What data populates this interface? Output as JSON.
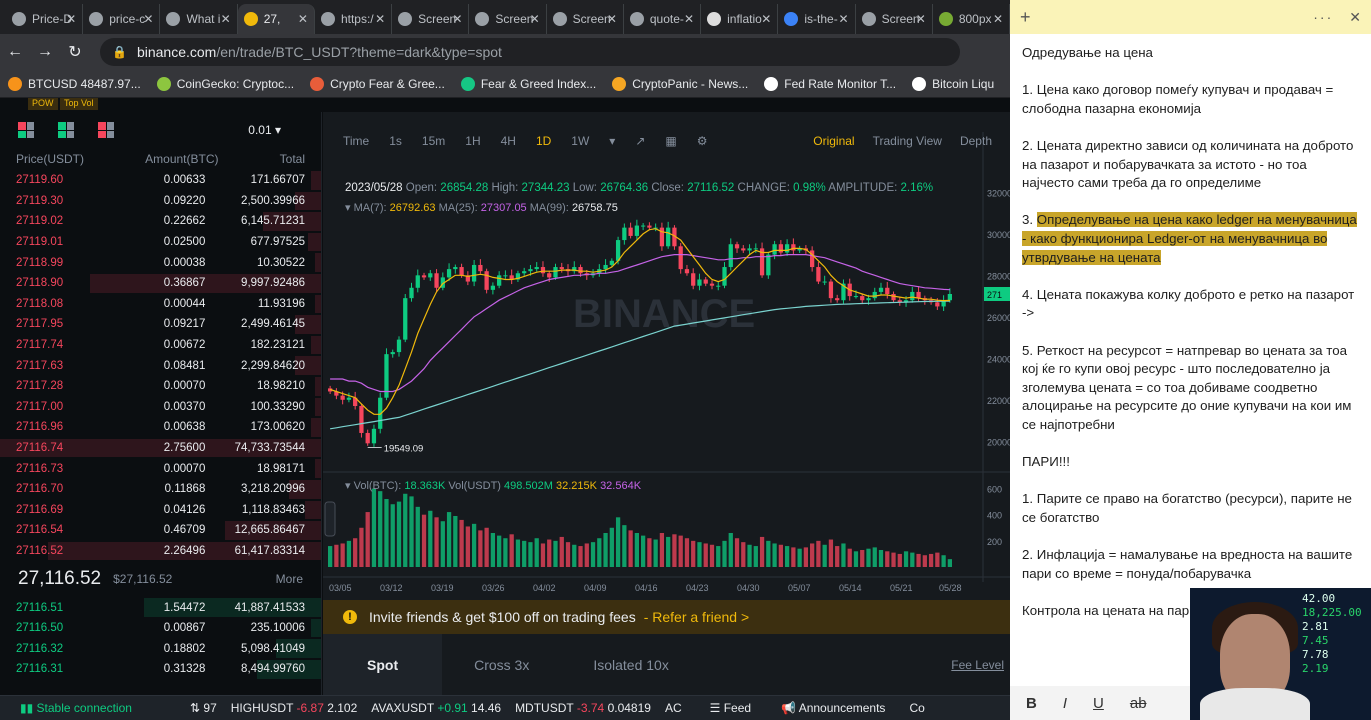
{
  "browser": {
    "tabs": [
      {
        "label": "Price-D",
        "color": "#9aa0a6"
      },
      {
        "label": "price-c",
        "color": "#9aa0a6"
      },
      {
        "label": "What i",
        "color": "#9aa0a6"
      },
      {
        "label": "27,",
        "color": "#f0b90b"
      },
      {
        "label": "https:/",
        "color": "#9aa0a6"
      },
      {
        "label": "Screen",
        "color": "#9aa0a6"
      },
      {
        "label": "Screen",
        "color": "#9aa0a6"
      },
      {
        "label": "Screen",
        "color": "#9aa0a6"
      },
      {
        "label": "quote-",
        "color": "#9aa0a6"
      },
      {
        "label": "inflatio",
        "color": "#dddddd"
      },
      {
        "label": "is-the-",
        "color": "#3b82f6"
      },
      {
        "label": "Screen",
        "color": "#9aa0a6"
      },
      {
        "label": "800px",
        "color": "#7a3"
      }
    ],
    "url_host": "binance.com",
    "url_path": "/en/trade/BTC_USDT?theme=dark&type=spot",
    "bookmarks": [
      {
        "label": "BTCUSD 48487.97...",
        "color": "#f7931a"
      },
      {
        "label": "CoinGecko: Cryptoc...",
        "color": "#8dc63f"
      },
      {
        "label": "Crypto Fear & Gree...",
        "color": "#e85d3a"
      },
      {
        "label": "Fear & Greed Index...",
        "color": "#16c784"
      },
      {
        "label": "CryptoPanic - News...",
        "color": "#f5a623"
      },
      {
        "label": "Fed Rate Monitor T...",
        "color": "#ffffff"
      },
      {
        "label": "Bitcoin Liqu",
        "color": "#ffffff"
      }
    ],
    "sub_tags": [
      "POW",
      "Top Vol"
    ]
  },
  "orderbook": {
    "precision": "0.01",
    "headers": {
      "price": "Price(USDT)",
      "amount": "Amount(BTC)",
      "total": "Total"
    },
    "asks": [
      {
        "p": "27119.60",
        "a": "0.00633",
        "t": "171.66707",
        "depth": 0.03
      },
      {
        "p": "27119.30",
        "a": "0.09220",
        "t": "2,500.39966",
        "depth": 0.08
      },
      {
        "p": "27119.02",
        "a": "0.22662",
        "t": "6,145.71231",
        "depth": 0.18
      },
      {
        "p": "27119.01",
        "a": "0.02500",
        "t": "677.97525",
        "depth": 0.04
      },
      {
        "p": "27118.99",
        "a": "0.00038",
        "t": "10.30522",
        "depth": 0.02
      },
      {
        "p": "27118.90",
        "a": "0.36867",
        "t": "9,997.92486",
        "depth": 0.72
      },
      {
        "p": "27118.08",
        "a": "0.00044",
        "t": "11.93196",
        "depth": 0.02
      },
      {
        "p": "27117.95",
        "a": "0.09217",
        "t": "2,499.46145",
        "depth": 0.08
      },
      {
        "p": "27117.74",
        "a": "0.00672",
        "t": "182.23121",
        "depth": 0.03
      },
      {
        "p": "27117.63",
        "a": "0.08481",
        "t": "2,299.84620",
        "depth": 0.08
      },
      {
        "p": "27117.28",
        "a": "0.00070",
        "t": "18.98210",
        "depth": 0.02
      },
      {
        "p": "27117.00",
        "a": "0.00370",
        "t": "100.33290",
        "depth": 0.02
      },
      {
        "p": "27116.96",
        "a": "0.00638",
        "t": "173.00620",
        "depth": 0.03
      },
      {
        "p": "27116.74",
        "a": "2.75600",
        "t": "74,733.73544",
        "depth": 1.0
      },
      {
        "p": "27116.73",
        "a": "0.00070",
        "t": "18.98171",
        "depth": 0.02
      },
      {
        "p": "27116.70",
        "a": "0.11868",
        "t": "3,218.20996",
        "depth": 0.1
      },
      {
        "p": "27116.69",
        "a": "0.04126",
        "t": "1,118.83463",
        "depth": 0.05
      },
      {
        "p": "27116.54",
        "a": "0.46709",
        "t": "12,665.86467",
        "depth": 0.3
      },
      {
        "p": "27116.52",
        "a": "2.26496",
        "t": "61,417.83314",
        "depth": 0.85
      }
    ],
    "last_price": "27,116.52",
    "last_price_usd": "$27,116.52",
    "more_label": "More",
    "bids": [
      {
        "p": "27116.51",
        "a": "1.54472",
        "t": "41,887.41533",
        "depth": 0.55
      },
      {
        "p": "27116.50",
        "a": "0.00867",
        "t": "235.10006",
        "depth": 0.03
      },
      {
        "p": "27116.32",
        "a": "0.18802",
        "t": "5,098.41049",
        "depth": 0.14
      },
      {
        "p": "27116.31",
        "a": "0.31328",
        "t": "8,494.99760",
        "depth": 0.2
      }
    ]
  },
  "chart": {
    "intervals": [
      "Time",
      "1s",
      "15m",
      "1H",
      "4H",
      "1D",
      "1W"
    ],
    "active_interval": "1D",
    "views": [
      "Original",
      "Trading View",
      "Depth"
    ],
    "active_view": "Original",
    "info_date": "2023/05/28",
    "info_open_label": "Open:",
    "info_open": "26854.28",
    "info_high_label": "High:",
    "info_high": "27344.23",
    "info_low_label": "Low:",
    "info_low": "26764.36",
    "info_close_label": "Close:",
    "info_close": "27116.52",
    "info_change_label": "CHANGE:",
    "info_change": "0.98%",
    "info_amp_label": "AMPLITUDE:",
    "info_amp": "2.16%",
    "ma7_label": "MA(7):",
    "ma7": "26792.63",
    "ma25_label": "MA(25):",
    "ma25": "27307.05",
    "ma99_label": "MA(99):",
    "ma99": "26758.75",
    "vol_btc_label": "Vol(BTC):",
    "vol_btc": "18.363K",
    "vol_usdt_label": "Vol(USDT)",
    "vol_usdt": "498.502M",
    "vol_ma1": "32.215K",
    "vol_ma2": "32.564K",
    "low_marker": "19549.09",
    "watermark": "BINANCE",
    "last_tag": "271",
    "colors": {
      "up": "#0ecb81",
      "down": "#f6465d",
      "ma7": "#f0b90b",
      "ma25": "#c563e7",
      "ma99": "#7ad3cf"
    }
  },
  "chart_data": {
    "type": "candlestick",
    "x_labels": [
      "03/05",
      "03/12",
      "03/19",
      "03/26",
      "04/02",
      "04/09",
      "04/16",
      "04/23",
      "04/30",
      "05/07",
      "05/14",
      "05/21",
      "05/28"
    ],
    "y_ticks": [
      "32000",
      "30000",
      "28000",
      "26000",
      "24000",
      "22000",
      "20000"
    ],
    "vol_ticks": [
      "600",
      "400",
      "200"
    ],
    "ylim": [
      19000,
      32500
    ],
    "closes": [
      22400,
      22200,
      22000,
      22100,
      21700,
      20400,
      19900,
      20600,
      22100,
      24200,
      24300,
      24900,
      26900,
      27400,
      28000,
      27900,
      28100,
      27400,
      27900,
      28300,
      28400,
      28000,
      27700,
      28500,
      28200,
      27300,
      27500,
      28000,
      28000,
      27800,
      28100,
      28200,
      28300,
      28400,
      28100,
      27900,
      28400,
      28300,
      28200,
      28400,
      28100,
      28000,
      28100,
      28300,
      28500,
      28700,
      29700,
      30300,
      29900,
      30400,
      30400,
      30300,
      30300,
      29400,
      30300,
      29400,
      28300,
      28100,
      27500,
      27800,
      27600,
      27500,
      27500,
      28400,
      29500,
      29300,
      29200,
      29300,
      29300,
      28000,
      29000,
      29500,
      29100,
      29500,
      29200,
      29300,
      29200,
      28400,
      27700,
      27700,
      26900,
      26800,
      27600,
      27000,
      27000,
      26800,
      26900,
      27200,
      27400,
      27100,
      26800,
      26700,
      26800,
      27200,
      26900,
      26800,
      26700,
      26500,
      26800,
      27100
    ],
    "vols": [
      160,
      170,
      180,
      200,
      220,
      300,
      420,
      600,
      580,
      520,
      480,
      500,
      560,
      540,
      460,
      400,
      430,
      380,
      350,
      420,
      390,
      360,
      310,
      330,
      280,
      300,
      260,
      240,
      220,
      250,
      210,
      200,
      190,
      220,
      180,
      210,
      200,
      230,
      190,
      170,
      160,
      180,
      190,
      220,
      260,
      300,
      380,
      320,
      280,
      260,
      240,
      220,
      210,
      260,
      230,
      250,
      240,
      220,
      200,
      190,
      180,
      170,
      160,
      200,
      260,
      220,
      190,
      170,
      160,
      230,
      200,
      180,
      170,
      160,
      150,
      140,
      150,
      180,
      200,
      170,
      210,
      160,
      180,
      140,
      120,
      130,
      140,
      150,
      130,
      120,
      110,
      100,
      120,
      110,
      100,
      90,
      100,
      110,
      90,
      60
    ],
    "ma7": [
      22500,
      22400,
      22300,
      22200,
      22100,
      21800,
      21500,
      21300,
      21300,
      21600,
      22100,
      22700,
      23500,
      24300,
      25200,
      25900,
      26600,
      27200,
      27600,
      27800,
      28000,
      28000,
      27950,
      28000,
      28050,
      28000,
      27900,
      27850,
      27800,
      27800,
      27850,
      27950,
      28050,
      28150,
      28200,
      28200,
      28200,
      28250,
      28250,
      28250,
      28200,
      28200,
      28150,
      28200,
      28250,
      28400,
      28700,
      29100,
      29400,
      29700,
      30000,
      30200,
      30250,
      30100,
      30050,
      29900,
      29700,
      29300,
      28900,
      28500,
      28100,
      27800,
      27700,
      27800,
      28100,
      28400,
      28700,
      29000,
      29200,
      29100,
      29100,
      29200,
      29200,
      29200,
      29300,
      29300,
      29250,
      29000,
      28700,
      28400,
      28000,
      27700,
      27500,
      27300,
      27200,
      27100,
      27000,
      27000,
      27050,
      27050,
      27000,
      26950,
      26900,
      26950,
      26900,
      26850,
      26850,
      26800,
      26780,
      26790
    ],
    "ma25": [
      23000,
      23000,
      23000,
      22900,
      22900,
      22800,
      22600,
      22500,
      22400,
      22400,
      22400,
      22500,
      22700,
      22900,
      23200,
      23500,
      23900,
      24200,
      24500,
      24800,
      25100,
      25400,
      25700,
      26000,
      26200,
      26400,
      26600,
      26800,
      26950,
      27100,
      27250,
      27400,
      27500,
      27600,
      27700,
      27800,
      27850,
      27900,
      27950,
      28000,
      28000,
      28050,
      28050,
      28100,
      28100,
      28150,
      28200,
      28300,
      28400,
      28500,
      28600,
      28700,
      28800,
      28900,
      28950,
      29000,
      29000,
      29000,
      28950,
      28900,
      28850,
      28800,
      28750,
      28750,
      28800,
      28800,
      28850,
      28850,
      28900,
      28900,
      28900,
      28950,
      28950,
      29000,
      29000,
      29000,
      29000,
      28950,
      28900,
      28850,
      28750,
      28650,
      28550,
      28450,
      28350,
      28200,
      28100,
      28000,
      27900,
      27800,
      27700,
      27600,
      27550,
      27500,
      27450,
      27400,
      27380,
      27350,
      27320,
      27307
    ],
    "ma99": [
      20600,
      20650,
      20700,
      20750,
      20800,
      20850,
      20900,
      20950,
      21000,
      21050,
      21100,
      21150,
      21250,
      21350,
      21450,
      21550,
      21650,
      21750,
      21850,
      21950,
      22050,
      22150,
      22250,
      22350,
      22450,
      22550,
      22650,
      22750,
      22850,
      22950,
      23050,
      23150,
      23250,
      23350,
      23450,
      23550,
      23650,
      23750,
      23850,
      23950,
      24050,
      24150,
      24250,
      24350,
      24450,
      24550,
      24650,
      24750,
      24850,
      24950,
      25050,
      25150,
      25250,
      25350,
      25450,
      25550,
      25600,
      25650,
      25700,
      25750,
      25800,
      25850,
      25900,
      25950,
      26000,
      26050,
      26100,
      26150,
      26200,
      26250,
      26300,
      26350,
      26380,
      26410,
      26440,
      26470,
      26500,
      26520,
      26540,
      26560,
      26580,
      26600,
      26610,
      26620,
      26630,
      26640,
      26650,
      26660,
      26670,
      26680,
      26690,
      26700,
      26710,
      26720,
      26730,
      26740,
      26745,
      26750,
      26755,
      26758
    ]
  },
  "banner": {
    "text": "Invite friends & get $100 off on trading fees",
    "link": "- Refer a friend >"
  },
  "trade_tabs": [
    "Spot",
    "Cross 3x",
    "Isolated 10x"
  ],
  "fee_level": "Fee Level",
  "status": {
    "connection": "Stable connection",
    "count": "97",
    "tickers": [
      {
        "sym": "HIGHUSDT",
        "chg": "-6.87",
        "price": "2.102",
        "neg": true
      },
      {
        "sym": "AVAXUSDT",
        "chg": "+0.91",
        "price": "14.46",
        "neg": false
      },
      {
        "sym": "MDTUSDT",
        "chg": "-3.74",
        "price": "0.04819",
        "neg": true
      },
      {
        "sym": "AC",
        "chg": "",
        "price": "",
        "neg": true
      }
    ],
    "feed": "Feed",
    "announcements": "Announcements",
    "more": "Co"
  },
  "notes": {
    "paragraphs": [
      {
        "text": "Одредување на цена",
        "hl": false
      },
      {
        "text": "1. Цена како договор помеѓу купувач и продавач = слободна пазарна економија",
        "hl": false
      },
      {
        "text": "2. Цената директно зависи од количината на доброто на пазарот и побарувачката за истото - но тоа најчесто сами треба да го определиме",
        "hl": false
      },
      {
        "prefix": "3. ",
        "text": "Определување на цена како ledger на менувачница - како функционира Ledger-от на менувачница во утврдување на цената",
        "hl": true
      },
      {
        "text": "4. Цената покажува колку доброто е ретко на пазарот ->",
        "hl": false
      },
      {
        "text": "5. Реткост на ресурсот = натпревар во цената за тоа кој ќе го купи овој ресурс - што последователно ја зголемува цената = со тоа добиваме соодветно алоцирање на ресурсите до оние купувачи на кои им се најпотребни",
        "hl": false
      },
      {
        "text": "ПАРИ!!!",
        "hl": false
      },
      {
        "text": "1. Парите се право на богатство (ресурси), парите не се богатство",
        "hl": false
      },
      {
        "text": "2. Инфлација = намалување на вредноста на вашите пари со време = понуда/побарувачка",
        "hl": false
      },
      {
        "text": "Контрола на цената на пар повлекување на парите од",
        "hl": false
      }
    ],
    "format_buttons": [
      "B",
      "I",
      "U",
      "ab"
    ],
    "webcam_ticker": [
      "42.00",
      "18,225.00",
      "2.81",
      "7.45",
      "7.78",
      "2.19"
    ]
  }
}
